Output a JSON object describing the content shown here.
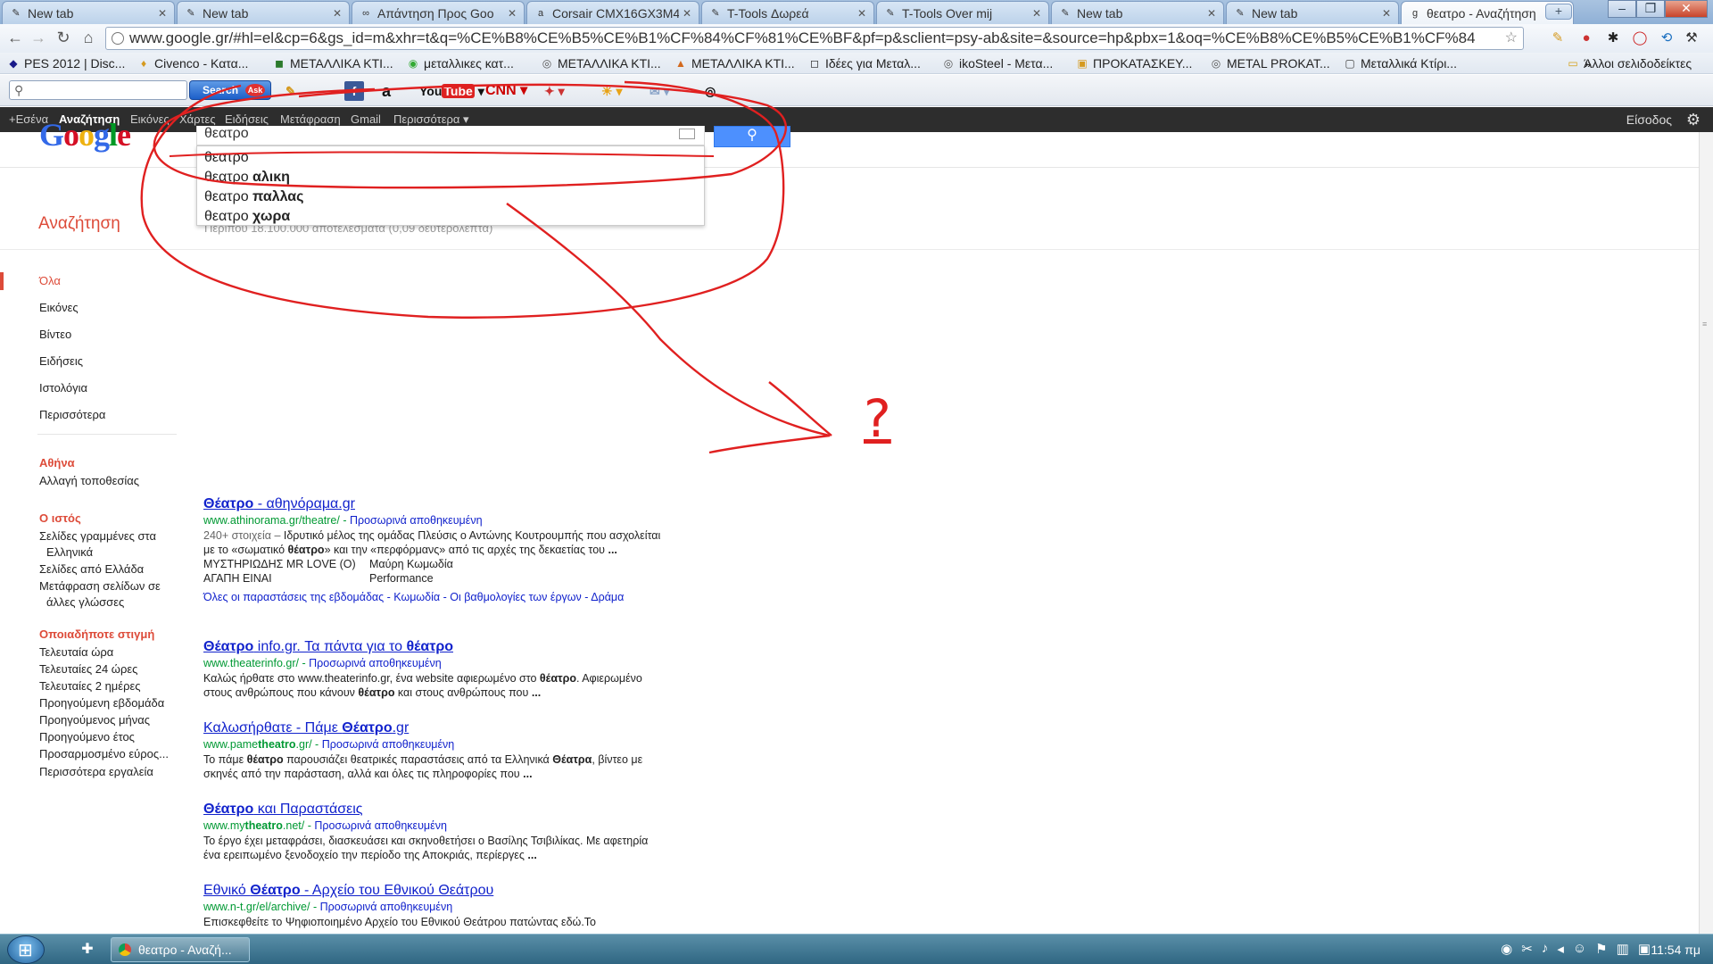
{
  "colors": {
    "google_red": "#dd4b39",
    "link_blue": "#1122cc",
    "url_green": "#009933",
    "annotation_red": "#e02020"
  },
  "browser": {
    "tabs": [
      {
        "title": "New tab",
        "icon": "page-icon",
        "active": false
      },
      {
        "title": "New tab",
        "icon": "page-icon",
        "active": false
      },
      {
        "title": "Απάντηση Προς Goo",
        "icon": "forum-icon",
        "active": false
      },
      {
        "title": "Corsair CMX16GX3M4",
        "icon": "amazon-icon",
        "active": false
      },
      {
        "title": "T-Tools Δωρεά",
        "icon": "page-icon",
        "active": false
      },
      {
        "title": "T-Tools Over mij",
        "icon": "page-icon",
        "active": false
      },
      {
        "title": "New tab",
        "icon": "page-icon",
        "active": false
      },
      {
        "title": "New tab",
        "icon": "page-icon",
        "active": false
      },
      {
        "title": "θεατρο - Αναζήτηση",
        "icon": "google-icon",
        "active": true
      }
    ],
    "url": "www.google.gr/#hl=el&cp=6&gs_id=m&xhr=t&q=%CE%B8%CE%B5%CE%B1%CF%84%CF%81%CE%BF&pf=p&sclient=psy-ab&site=&source=hp&pbx=1&oq=%CE%B8%CE%B5%CE%B1%CF%84",
    "bookmarks": [
      "PES 2012 | Disc...",
      "Civenco - Κατα...",
      "ΜΕΤΑΛΛΙΚΑ ΚΤΙ...",
      "μεταλλικες κατ...",
      "ΜΕΤΑΛΛΙΚΑ ΚΤΙ...",
      "ΜΕΤΑΛΛΙΚΑ ΚΤΙ...",
      "Ιδέες για Μεταλ...",
      "ikoSteel - Μετα...",
      "ΠΡΟΚΑΤΑΣΚΕΥ...",
      "METAL PROKAT...",
      "Μεταλλικά Κτίρι..."
    ],
    "other_bookmarks": "Άλλοι σελιδοδείκτες"
  },
  "ask_toolbar": {
    "search_label": "Search",
    "ask_logo": "Ask",
    "youtube": "You",
    "youtube2": "Tube",
    "cnn": "CNN"
  },
  "gbar": {
    "items": [
      "+Εσένα",
      "Αναζήτηση",
      "Εικόνες",
      "Χάρτες",
      "Ειδήσεις",
      "Μετάφραση",
      "Gmail",
      "Περισσότερα ▾"
    ],
    "signin": "Είσοδος"
  },
  "search": {
    "query": "θεατρο",
    "suggestions": [
      {
        "base": "θεατρο",
        "bold": ""
      },
      {
        "base": "θεατρο ",
        "bold": "αλικη"
      },
      {
        "base": "θεατρο ",
        "bold": "παλλας"
      },
      {
        "base": "θεατρο ",
        "bold": "χωρα"
      }
    ],
    "stats": "Περίπου 18.100.000 αποτελέσματα (0,09 δευτερόλεπτα)",
    "section_title": "Αναζήτηση"
  },
  "left_nav": {
    "modes": [
      "Όλα",
      "Εικόνες",
      "Βίντεο",
      "Ειδήσεις",
      "Ιστολόγια",
      "Περισσότερα"
    ],
    "location": {
      "header": "Αθήνα",
      "change": "Αλλαγή τοποθεσίας"
    },
    "web": {
      "header": "Ο ιστός",
      "items": [
        "Σελίδες γραμμένες στα Ελληνικά",
        "Σελίδες από Ελλάδα",
        "Μετάφραση σελίδων σε άλλες γλώσσες"
      ]
    },
    "time": {
      "header": "Οποιαδήποτε στιγμή",
      "items": [
        "Τελευταία ώρα",
        "Τελευταίες 24 ώρες",
        "Τελευταίες 2 ημέρες",
        "Προηγούμενη εβδομάδα",
        "Προηγούμενος μήνας",
        "Προηγούμενο έτος",
        "Προσαρμοσμένο εύρος..."
      ]
    },
    "more_tools": "Περισσότερα εργαλεία"
  },
  "results": [
    {
      "title_html": "<b>Θέατρο</b> - αθηνόραμα.gr",
      "url": "www.athinorama.gr/theatre/",
      "cache": "Προσωρινά αποθηκευμένη",
      "meta": "240+ στοιχεία – ",
      "snippet_html": "Ιδρυτικό μέλος της ομάδας Πλεύσις ο Αντώνης Κουτρουμπής που ασχολείται με το «σωματικό <b>θέατρο</b>» και την «περφόρμανς» από τις αρχές της δεκαετίας του <b>...</b>",
      "table": [
        "ΜΥΣΤΗΡΙΩΔΗΣ MR LOVE (Ο)",
        "Μαύρη Κωμωδία",
        "ΑΓΑΠΗ ΕΙΝΑΙ",
        "Performance"
      ],
      "sitelinks": "Όλες οι παραστάσεις της εβδομάδας - Κωμωδία - Οι βαθμολογίες των έργων - Δράμα"
    },
    {
      "title_html": "<b>Θέατρο</b> info.gr. Τα πάντα για το <b>θέατρο</b>",
      "url": "www.theaterinfo.gr/",
      "cache": "Προσωρινά αποθηκευμένη",
      "snippet_html": "Καλώς ήρθατε στο www.theaterinfo.gr, ένα website αφιερωμένο στο <b>θέατρο</b>. Αφιερωμένο στους ανθρώπους που κάνουν <b>θέατρο</b> και στους ανθρώπους που <b>...</b>"
    },
    {
      "title_html": "Καλωσήρθατε - Πάμε <b>Θέατρο</b>.gr",
      "url_html": "www.pame<b>theatro</b>.gr/",
      "cache": "Προσωρινά αποθηκευμένη",
      "snippet_html": "Το πάμε <b>θέατρο</b> παρουσιάζει θεατρικές παραστάσεις από τα Ελληνικά <b>Θέατρα</b>, βίντεο με σκηνές από την παράσταση, αλλά και όλες τις πληροφορίες που <b>...</b>"
    },
    {
      "title_html": "<b>Θέατρο</b> και Παραστάσεις",
      "url_html": "www.my<b>theatro</b>.net/",
      "cache": "Προσωρινά αποθηκευμένη",
      "snippet_html": "Το έργο έχει μεταφράσει, διασκευάσει και σκηνοθετήσει ο Βασίλης Τσιβιλίκας. Με αφετηρία ένα ερειπωμένο ξενοδοχείο την περίοδο της Αποκριάς, περίεργες <b>...</b>"
    },
    {
      "title_html": "Εθνικό <b>Θέατρο</b> - Αρχείο του Εθνικού Θεάτρου",
      "url": "www.n-t.gr/el/archive/",
      "cache": "Προσωρινά αποθηκευμένη",
      "snippet_html": "Επισκεφθείτε το Ψηφιοποιημένο Αρχείο του Εθνικού Θεάτρου πατώντας εδώ.Το"
    }
  ],
  "annotation": {
    "mark": "?"
  },
  "taskbar": {
    "app_title": "θεατρο - Αναζή...",
    "clock": "11:54 πμ"
  }
}
